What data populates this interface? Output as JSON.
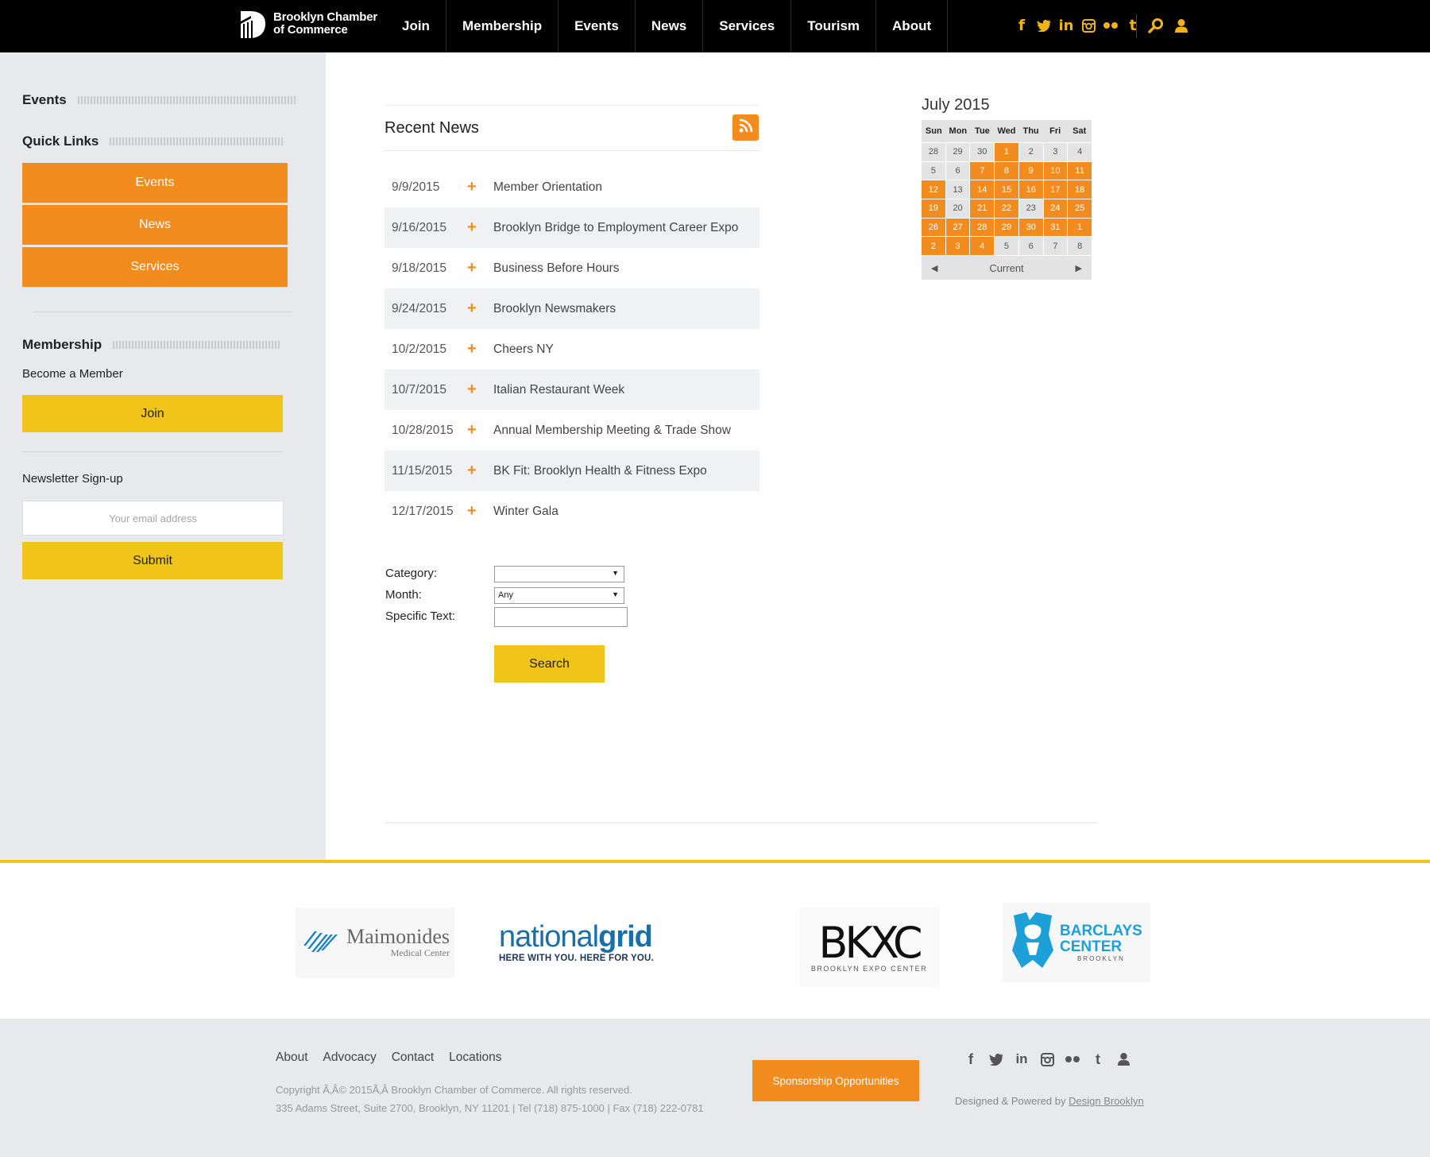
{
  "header": {
    "logo_line1": "Brooklyn Chamber",
    "logo_line2": "of Commerce",
    "nav": [
      "Join",
      "Membership",
      "Events",
      "News",
      "Services",
      "Tourism",
      "About"
    ],
    "social_icons": [
      "facebook-icon",
      "twitter-icon",
      "linkedin-icon",
      "instagram-icon",
      "flickr-icon",
      "tumblr-icon"
    ],
    "tool_icons": [
      "search-icon",
      "user-icon"
    ],
    "accent_color": "#f2b21a"
  },
  "sidebar": {
    "events_heading": "Events",
    "quick_links_heading": "Quick Links",
    "quick_links": [
      "Events",
      "News",
      "Services"
    ],
    "membership_heading": "Membership",
    "become_member": "Become a Member",
    "join_label": "Join",
    "newsletter_heading": "Newsletter Sign-up",
    "email_placeholder": "Your email address",
    "submit_label": "Submit"
  },
  "news": {
    "title": "Recent News",
    "items": [
      {
        "date": "9/9/2015",
        "title": "Member Orientation"
      },
      {
        "date": "9/16/2015",
        "title": "Brooklyn Bridge to Employment Career Expo"
      },
      {
        "date": "9/18/2015",
        "title": "Business Before Hours"
      },
      {
        "date": "9/24/2015",
        "title": "Brooklyn Newsmakers"
      },
      {
        "date": "10/2/2015",
        "title": "Cheers NY"
      },
      {
        "date": "10/7/2015",
        "title": "Italian Restaurant Week"
      },
      {
        "date": "10/28/2015",
        "title": "Annual Membership Meeting & Trade Show"
      },
      {
        "date": "11/15/2015",
        "title": "BK Fit: Brooklyn Health & Fitness Expo"
      },
      {
        "date": "12/17/2015",
        "title": "Winter Gala"
      }
    ],
    "plus_glyph": "+"
  },
  "search_form": {
    "category_label": "Category:",
    "category_value": "",
    "month_label": "Month:",
    "month_value": "Any",
    "text_label": "Specific Text:",
    "text_value": "",
    "search_label": "Search"
  },
  "calendar": {
    "title": "July 2015",
    "weekdays": [
      "Sun",
      "Mon",
      "Tue",
      "Wed",
      "Thu",
      "Fri",
      "Sat"
    ],
    "weeks": [
      [
        "28",
        "29",
        "30",
        "1",
        "2",
        "3",
        "4"
      ],
      [
        "5",
        "6",
        "7",
        "8",
        "9",
        "10",
        "11"
      ],
      [
        "12",
        "13",
        "14",
        "15",
        "16",
        "17",
        "18"
      ],
      [
        "19",
        "20",
        "21",
        "22",
        "23",
        "24",
        "25"
      ],
      [
        "26",
        "27",
        "28",
        "29",
        "30",
        "31",
        "1"
      ],
      [
        "2",
        "3",
        "4",
        "5",
        "6",
        "7",
        "8"
      ]
    ],
    "highlighted": [
      [
        false,
        false,
        false,
        true,
        false,
        false,
        false
      ],
      [
        false,
        false,
        true,
        true,
        true,
        true,
        true
      ],
      [
        true,
        false,
        true,
        true,
        true,
        true,
        true
      ],
      [
        true,
        false,
        true,
        true,
        false,
        true,
        true
      ],
      [
        true,
        true,
        true,
        true,
        true,
        true,
        true
      ],
      [
        true,
        true,
        true,
        false,
        false,
        false,
        false
      ]
    ],
    "current_label": "Current",
    "highlight_color": "#f28c1e"
  },
  "sponsors": {
    "maimonides": {
      "name": "Maimonides",
      "sub": "Medical Center"
    },
    "nationalgrid": {
      "name_a": "national",
      "name_b": "grid",
      "tagline": "HERE WITH YOU. HERE FOR YOU."
    },
    "bkxc": {
      "name": "BKXC",
      "sub": "BROOKLYN EXPO CENTER"
    },
    "barclays": {
      "line1": "BARCLAYS",
      "line2": "CENTER",
      "sub": "BROOKLYN"
    }
  },
  "footer": {
    "links": [
      "About",
      "Advocacy",
      "Contact",
      "Locations"
    ],
    "copyright": "Copyright Ã‚Â© 2015Ã‚Â Brooklyn Chamber of Commerce. All rights reserved.",
    "address": "335 Adams Street, Suite 2700, Brooklyn, NY 11201 | Tel (718) 875-1000 | Fax (718) 222-0781",
    "sponsorship_label": "Sponsorship Opportunities",
    "social_icons": [
      "facebook-icon",
      "twitter-icon",
      "linkedin-icon",
      "instagram-icon",
      "flickr-icon",
      "tumblr-icon",
      "user-icon"
    ],
    "credit_prefix": "Designed & Powered by",
    "credit_link": "Design Brooklyn"
  }
}
